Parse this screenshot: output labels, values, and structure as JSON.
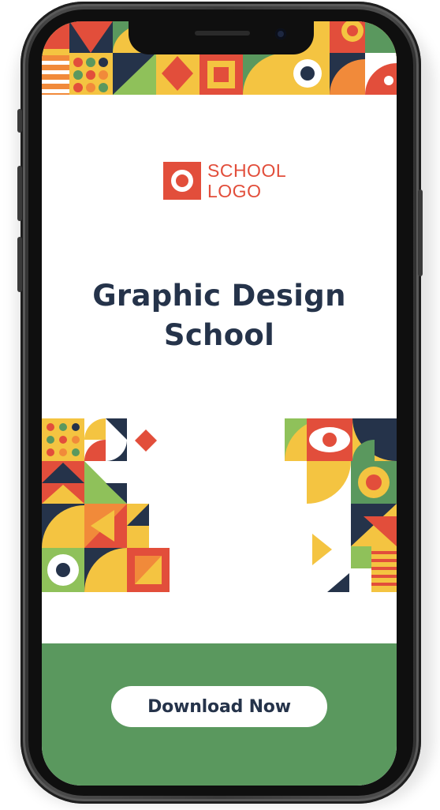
{
  "brand": {
    "logo_line1": "SCHOOL",
    "logo_line2": "LOGO"
  },
  "headline": {
    "line1": "Graphic Design",
    "line2": "School"
  },
  "cta": {
    "label": "Download Now"
  },
  "colors": {
    "red": "#e24e3b",
    "navy": "#25334a",
    "yellow": "#f4c441",
    "green": "#5a985e",
    "lime": "#8fc15a",
    "orange": "#f18a3a",
    "white": "#ffffff"
  }
}
